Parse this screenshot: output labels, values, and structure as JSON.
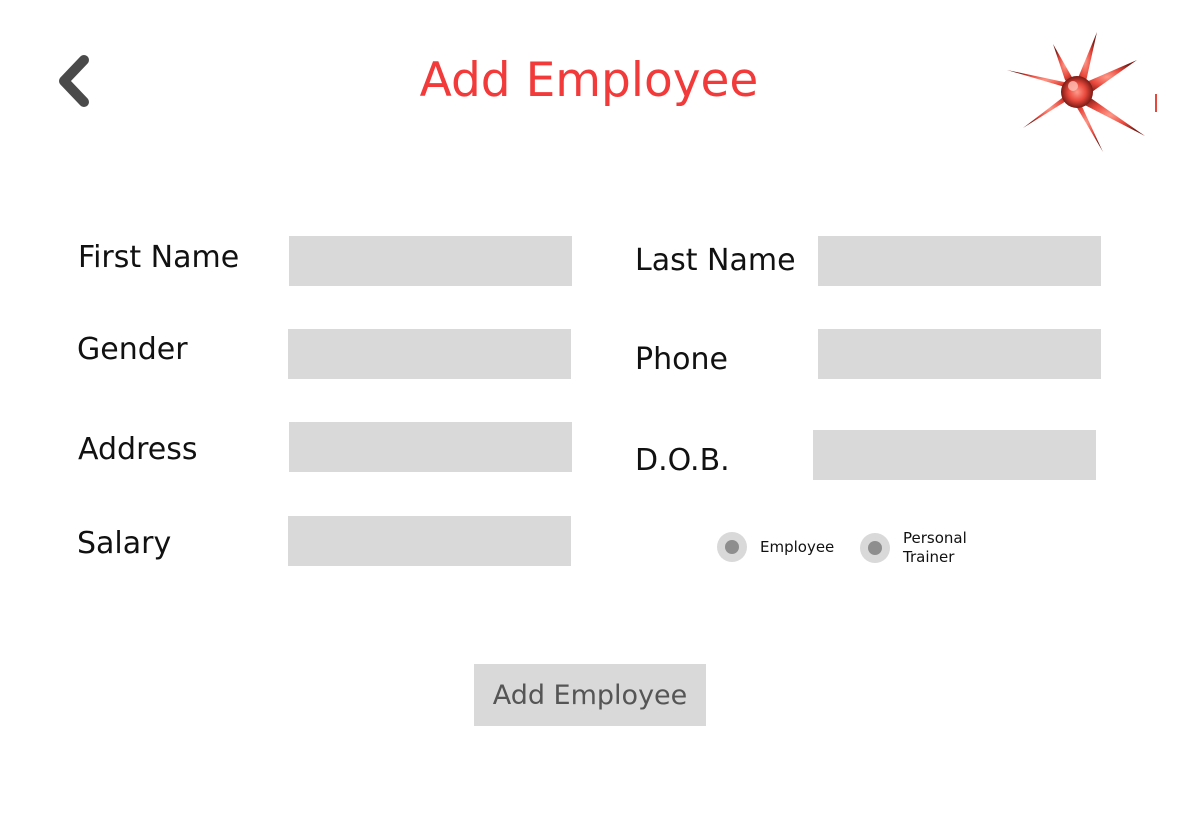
{
  "header": {
    "title": "Add Employee",
    "back_icon": "chevron-left-icon",
    "logo_icon": "red-starburst-logo"
  },
  "form": {
    "fields": {
      "first_name": {
        "label": "First Name",
        "value": ""
      },
      "last_name": {
        "label": "Last Name",
        "value": ""
      },
      "gender": {
        "label": "Gender",
        "value": ""
      },
      "phone": {
        "label": "Phone",
        "value": ""
      },
      "address": {
        "label": "Address",
        "value": ""
      },
      "dob": {
        "label": "D.O.B.",
        "value": ""
      },
      "salary": {
        "label": "Salary",
        "value": ""
      }
    },
    "role_options": [
      {
        "label": "Employee"
      },
      {
        "label": "Personal Trainer"
      }
    ],
    "submit_label": "Add Employee"
  },
  "colors": {
    "title": "#f23a3a",
    "input_bg": "#d9d9d9",
    "radio_dot": "#8e8e8e",
    "button_text": "#555555"
  }
}
